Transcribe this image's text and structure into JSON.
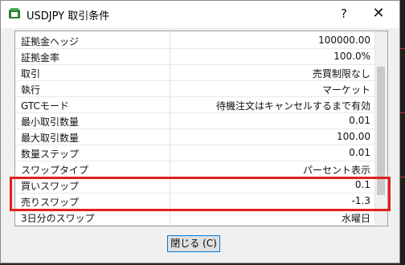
{
  "window": {
    "title": "USDJPY 取引条件",
    "help_label": "?",
    "close_label": "✕"
  },
  "colors": {
    "highlight": "#e02020",
    "button_border": "#0078d7"
  },
  "rows": [
    {
      "label": "証拠金ヘッジ",
      "value": "100000.00"
    },
    {
      "label": "証拠金率",
      "value": "100.0%"
    },
    {
      "label": "取引",
      "value": "売買制限なし"
    },
    {
      "label": "執行",
      "value": "マーケット"
    },
    {
      "label": "GTCモード",
      "value": "待機注文はキャンセルするまで有効"
    },
    {
      "label": "最小取引数量",
      "value": "0.01"
    },
    {
      "label": "最大取引数量",
      "value": "100.00"
    },
    {
      "label": "数量ステップ",
      "value": "0.01"
    },
    {
      "label": "スワップタイプ",
      "value": "パーセント表示"
    },
    {
      "label": "買いスワップ",
      "value": "0.1"
    },
    {
      "label": "売りスワップ",
      "value": "-1.3"
    },
    {
      "label": "3日分のスワップ",
      "value": "水曜日"
    }
  ],
  "footer": {
    "close_button_label": "閉じる (C)"
  }
}
